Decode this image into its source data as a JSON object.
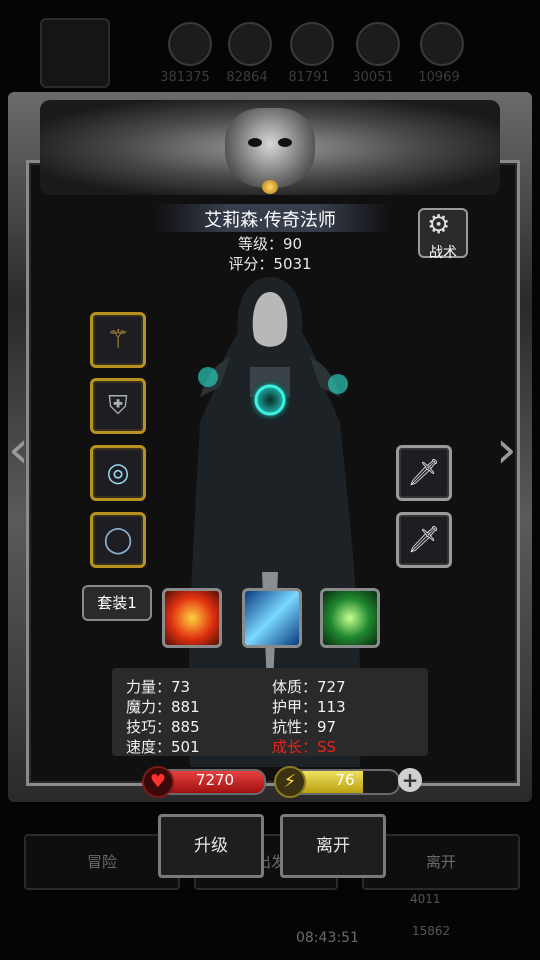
{
  "background": {
    "resources": [
      "381375",
      "82864",
      "81791",
      "30051",
      "10969"
    ],
    "menu": {
      "adventure": "冒险",
      "exit": "离开",
      "partial": "出发"
    },
    "time": "08:43:51",
    "counters": [
      "4011",
      "15862"
    ]
  },
  "character": {
    "name": "艾莉森·传奇法师",
    "level": "等级：90",
    "score": "评分：5031"
  },
  "tactic_label": "战术",
  "set_label": "套装1",
  "stats": {
    "strength": "力量：73",
    "magic": "魔力：881",
    "skill": "技巧：885",
    "speed": "速度：501",
    "constitution": "体质：727",
    "armor": "护甲：113",
    "resistance": "抗性：97",
    "growth": "成长：SS"
  },
  "hp": "7270",
  "energy": "76",
  "energy_fill": 0.7,
  "buttons": {
    "upgrade": "升级",
    "leave": "离开"
  },
  "colors": {
    "growth": "#e8231b",
    "gold_border": "#b8921e",
    "hp": "#c82020",
    "energy": "#d8c030"
  },
  "icons": {
    "left_slots": [
      "staff-icon",
      "armor-icon",
      "ring-icon",
      "bracelet-icon"
    ],
    "right_slots": [
      "dagger-icon",
      "dagger-icon"
    ],
    "skills": [
      "fire-skill-icon",
      "ice-skill-icon",
      "nature-skill-icon"
    ]
  }
}
